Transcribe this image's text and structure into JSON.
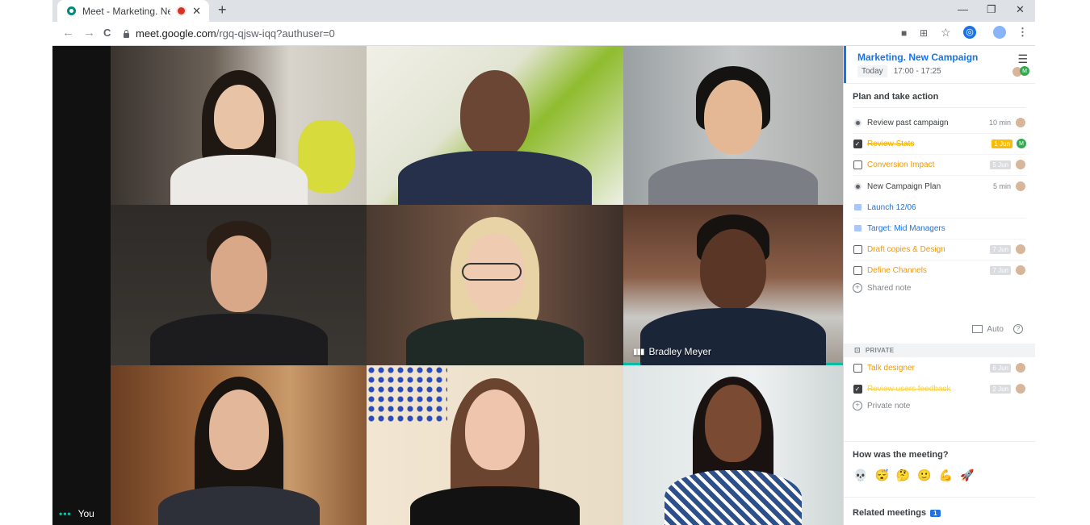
{
  "browser": {
    "tab_title": "Meet - Marketing. New Cam",
    "tab_close": "✕",
    "new_tab": "+",
    "window_controls": {
      "minimize": "—",
      "maximize": "❐",
      "close": "✕"
    },
    "nav": {
      "back": "←",
      "forward": "→",
      "reload": "C"
    },
    "url_host": "meet.google.com",
    "url_path": "/rgq-qjsw-iqq?authuser=0"
  },
  "meet": {
    "self_label": "You",
    "self_dots": "•••",
    "speaker_name": "Bradley Meyer",
    "participants": 9
  },
  "panel": {
    "meeting_title": "Marketing. New Campaign",
    "today_label": "Today",
    "time_range": "17:00 - 17:25",
    "avatar_m": "M",
    "agenda_heading": "Plan and take action",
    "agenda": [
      {
        "type": "topic",
        "text": "Review past campaign",
        "meta": "10 min"
      },
      {
        "type": "task",
        "text": "Review Stats",
        "date": "1 Jun",
        "done": true,
        "assignee": "M"
      },
      {
        "type": "task",
        "text": "Conversion Impact",
        "date": "5 Jun",
        "done": false
      },
      {
        "type": "topic",
        "text": "New Campaign Plan",
        "meta": "5 min"
      },
      {
        "type": "flag",
        "text": "Launch 12/06"
      },
      {
        "type": "flag",
        "text": "Target: Mid Managers"
      },
      {
        "type": "task",
        "text": "Draft copies & Design",
        "date": "7 Jun",
        "done": false
      },
      {
        "type": "task",
        "text": "Define Channels",
        "date": "7 Jun",
        "done": false
      }
    ],
    "shared_note": "Shared note",
    "auto_label": "Auto",
    "help_glyph": "?",
    "private_label": "PRIVATE",
    "private_items": [
      {
        "text": "Talk designer",
        "date": "6 Jun",
        "done": false
      },
      {
        "text": "Review users feedback",
        "date": "2 Jun",
        "done": true
      }
    ],
    "private_note": "Private note",
    "feedback_heading": "How was the meeting?",
    "feedback_emojis": [
      "💀",
      "😴",
      "🤔",
      "🙂",
      "💪",
      "🚀"
    ],
    "related_heading": "Related meetings",
    "related_count": "1"
  }
}
